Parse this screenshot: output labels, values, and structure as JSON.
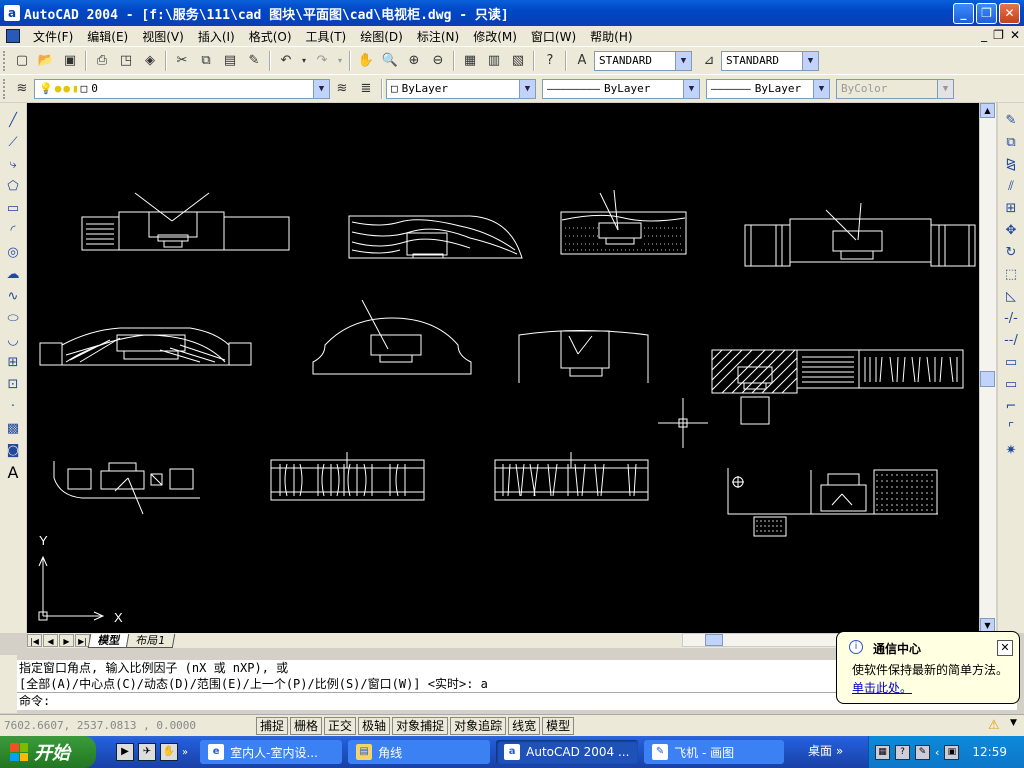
{
  "window": {
    "title": "AutoCAD 2004 - [f:\\服务\\111\\cad 图块\\平面图\\cad\\电视柜.dwg - 只读]",
    "app_icon_letter": "a",
    "min": "_",
    "max": "❐",
    "close": "✕"
  },
  "menu": {
    "items": [
      "文件(F)",
      "编辑(E)",
      "视图(V)",
      "插入(I)",
      "格式(O)",
      "工具(T)",
      "绘图(D)",
      "标注(N)",
      "修改(M)",
      "窗口(W)",
      "帮助(H)"
    ],
    "mdi_min": "_",
    "mdi_max": "❐",
    "mdi_close": "✕"
  },
  "toolbar1": {
    "textstyle": "STANDARD",
    "dimstyle": "STANDARD"
  },
  "toolbar2": {
    "layer": "0",
    "color": "ByLayer",
    "linetype": "ByLayer",
    "lineweight": "ByLayer",
    "plotstyle": "ByColor"
  },
  "drawing": {
    "ucs_x": "X",
    "ucs_y": "Y"
  },
  "tabs": {
    "items": [
      "模型",
      "布局1"
    ]
  },
  "command": {
    "line1": "指定窗口角点, 输入比例因子 (nX 或 nXP), 或",
    "line2": "[全部(A)/中心点(C)/动态(D)/范围(E)/上一个(P)/比例(S)/窗口(W)] <实时>: a",
    "prompt": "命令:"
  },
  "status": {
    "coords": "7602.6607,  2537.0813 , 0.0000",
    "buttons": [
      "捕捉",
      "栅格",
      "正交",
      "极轴",
      "对象捕捉",
      "对象追踪",
      "线宽",
      "模型"
    ]
  },
  "balloon": {
    "title": "通信中心",
    "text": "使软件保持最新的简单方法。",
    "link": "单击此处。"
  },
  "taskbar": {
    "start": "开始",
    "tasks": [
      "室内人-室内设...",
      "角线",
      "AutoCAD 2004 ...",
      "飞机 - 画图"
    ],
    "desktop": "桌面",
    "clock": "12:59"
  },
  "colors": {
    "drawing_bg": "#000000",
    "cad_lines": "#ffffff",
    "title_blue": "#0a5fd9"
  }
}
